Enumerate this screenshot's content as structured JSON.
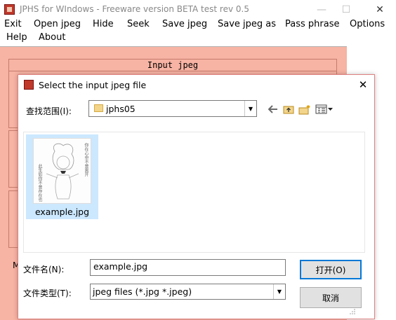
{
  "window": {
    "title": "JPHS for WIndows - Freeware version BETA test rev 0.5",
    "controls": {
      "minimize": "—",
      "maximize": "☐",
      "close": "✕"
    }
  },
  "menu": {
    "row1": [
      "Exit",
      "Open jpeg",
      "Hide",
      "Seek",
      "Save jpeg",
      "Save jpeg as",
      "Pass phrase",
      "Options"
    ],
    "row2": [
      "Help",
      "About"
    ]
  },
  "main": {
    "input_group_title": "Input jpeg",
    "partial_label_left": "M"
  },
  "dialog": {
    "title": "Select the input jpeg file",
    "close_glyph": "✕",
    "lookin_label": "查找范围(I):",
    "lookin_value": "jphs05",
    "toolbar_icons": [
      "back-arrow-icon",
      "up-folder-icon",
      "new-folder-icon",
      "view-menu-icon"
    ],
    "files": [
      {
        "name": "example.jpg",
        "selected": true,
        "thumbnail_caption_left": "此生如你不曾存在也",
        "thumbnail_caption_right": "你在心中不曾离开"
      }
    ],
    "filename_label": "文件名(N):",
    "filename_value": "example.jpg",
    "filetype_label": "文件类型(T):",
    "filetype_value": "jpeg files (*.jpg *.jpeg)",
    "open_button": "打开(O)",
    "cancel_button": "取消"
  },
  "colors": {
    "main_background": "#f7b3a3",
    "selection": "#cce8ff",
    "accent_border": "#0078d7"
  }
}
